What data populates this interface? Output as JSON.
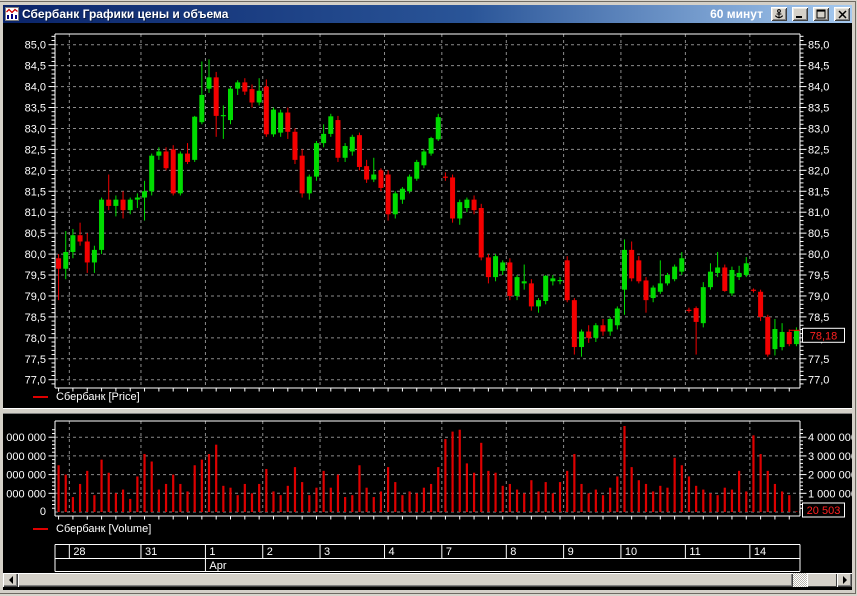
{
  "titlebar": {
    "title": "Сбербанк Графики цены и объема",
    "interval": "60 минут",
    "buttons": {
      "anchor": "anchor",
      "minimize": "minimize",
      "maximize": "maximize",
      "close": "close"
    }
  },
  "price_panel": {
    "legend": "Сбербанк [Price]",
    "y_ticks": [
      "85,0",
      "84,5",
      "84,0",
      "83,5",
      "83,0",
      "82,5",
      "82,0",
      "81,5",
      "81,0",
      "80,5",
      "80,0",
      "79,5",
      "79,0",
      "78,5",
      "78,0",
      "77,5",
      "77,0"
    ],
    "current_price_label": "78,18"
  },
  "volume_panel": {
    "legend": "Сбербанк [Volume]",
    "left_tick_labels": [
      "000 000",
      "000 000",
      "000 000",
      "000 000",
      "0"
    ],
    "right_tick_labels": [
      "4 000 000",
      "3 000 000",
      "2 000 000",
      "1 000 000"
    ],
    "current_volume_label": "20 503"
  },
  "date_axis": {
    "cells": [
      "",
      "28",
      "31",
      "1",
      "2",
      "3",
      "4",
      "7",
      "8",
      "9",
      "10",
      "11",
      "14"
    ],
    "month_label": "Apr",
    "month_start_day_label": "1"
  },
  "colors": {
    "candle_up": "#00DC00",
    "candle_down": "#F40000",
    "volume_bar": "#DE0000",
    "grid": "#8C8C8C",
    "axis_line": "#FFFFFF",
    "axis_text": "#FFFFFF",
    "marker_text": "#FF2020",
    "titlebar_left": "#0A246A",
    "titlebar_right": "#A6CAF0"
  },
  "chart_data": {
    "type": "candlestick+volume",
    "title": "Сбербанк Графики цены и объема",
    "interval": "60 минут",
    "price_ylim": [
      77.0,
      85.0
    ],
    "price_tick_step": 0.5,
    "volume_ylim": [
      0,
      4000000
    ],
    "volume_tick_step": 1000000,
    "grid": true,
    "current": {
      "price": 78.18,
      "volume": 20503
    },
    "days": [
      {
        "label": "",
        "candles": [
          [
            79.9,
            80.0,
            78.9,
            79.65,
            2500000
          ],
          [
            79.65,
            80.55,
            79.4,
            80.05,
            2000000
          ]
        ]
      },
      {
        "label": "28",
        "candles": [
          [
            80.05,
            80.6,
            79.9,
            80.45,
            800000
          ],
          [
            80.45,
            80.75,
            80.2,
            80.3,
            1500000
          ],
          [
            80.3,
            80.5,
            79.55,
            79.8,
            2200000
          ],
          [
            79.8,
            80.2,
            79.55,
            80.1,
            900000
          ],
          [
            80.1,
            81.35,
            80.0,
            81.3,
            2800000
          ],
          [
            81.3,
            81.9,
            81.05,
            81.15,
            2100000
          ],
          [
            81.15,
            81.4,
            80.9,
            81.3,
            1000000
          ],
          [
            81.3,
            81.5,
            80.85,
            81.05,
            1200000
          ],
          [
            81.05,
            81.35,
            80.95,
            81.3,
            700000
          ],
          [
            81.3,
            81.45,
            81.1,
            81.35,
            1900000
          ]
        ]
      },
      {
        "label": "31",
        "candles": [
          [
            81.35,
            81.75,
            80.8,
            81.5,
            3100000
          ],
          [
            81.5,
            82.4,
            81.4,
            82.35,
            2700000
          ],
          [
            82.35,
            82.55,
            82.25,
            82.45,
            1200000
          ],
          [
            82.45,
            82.55,
            82.0,
            82.05,
            1500000
          ],
          [
            82.5,
            82.6,
            81.4,
            81.45,
            2000000
          ],
          [
            81.45,
            82.45,
            81.4,
            82.4,
            1500000
          ],
          [
            82.4,
            82.65,
            82.15,
            82.2,
            1100000
          ],
          [
            82.25,
            83.3,
            82.2,
            83.28,
            2500000
          ],
          [
            83.15,
            84.6,
            83.1,
            83.8,
            2800000
          ]
        ]
      },
      {
        "label": "1",
        "candles": [
          [
            83.95,
            84.65,
            83.85,
            84.22,
            3100000
          ],
          [
            84.22,
            84.35,
            82.8,
            83.3,
            3600000
          ],
          [
            83.3,
            83.55,
            82.75,
            83.32,
            1400000
          ],
          [
            83.2,
            84.0,
            83.1,
            83.95,
            1300000
          ],
          [
            83.95,
            84.15,
            83.8,
            84.1,
            900000
          ],
          [
            84.1,
            84.2,
            83.8,
            83.88,
            1500000
          ],
          [
            83.94,
            84.05,
            83.5,
            83.62,
            1000000
          ],
          [
            83.62,
            84.2,
            83.55,
            83.9,
            1500000
          ]
        ]
      },
      {
        "label": "2",
        "candles": [
          [
            84.0,
            84.17,
            82.8,
            82.86,
            2300000
          ],
          [
            82.86,
            83.5,
            82.8,
            83.45,
            1100000
          ],
          [
            82.9,
            83.45,
            82.8,
            83.38,
            900000
          ],
          [
            83.38,
            83.5,
            82.75,
            82.92,
            1400000
          ],
          [
            82.92,
            83.0,
            82.15,
            82.25,
            2400000
          ],
          [
            82.35,
            82.5,
            81.35,
            81.45,
            1600000
          ],
          [
            81.45,
            81.9,
            81.3,
            81.85,
            900000
          ],
          [
            81.85,
            82.7,
            81.75,
            82.65,
            1300000
          ]
        ]
      },
      {
        "label": "3",
        "candles": [
          [
            82.65,
            83.1,
            82.55,
            82.87,
            2200000
          ],
          [
            82.87,
            83.35,
            82.8,
            83.29,
            1300000
          ],
          [
            83.2,
            83.3,
            82.2,
            82.3,
            2000000
          ],
          [
            82.3,
            82.65,
            82.2,
            82.58,
            800000
          ],
          [
            82.45,
            82.85,
            82.35,
            82.8,
            900000
          ],
          [
            82.84,
            82.9,
            82.0,
            82.08,
            2500000
          ],
          [
            82.1,
            82.25,
            81.7,
            81.78,
            1300000
          ],
          [
            81.78,
            82.3,
            81.72,
            81.9,
            800000
          ],
          [
            82.0,
            82.05,
            81.5,
            81.58,
            1100000
          ]
        ]
      },
      {
        "label": "4",
        "candles": [
          [
            81.9,
            82.0,
            80.8,
            80.95,
            2400000
          ],
          [
            80.95,
            81.5,
            80.85,
            81.45,
            1600000
          ],
          [
            81.3,
            81.6,
            81.2,
            81.56,
            900000
          ],
          [
            81.5,
            81.9,
            81.45,
            81.85,
            1100000
          ],
          [
            81.8,
            82.25,
            81.75,
            82.2,
            1000000
          ],
          [
            82.12,
            82.5,
            82.05,
            82.45,
            1300000
          ],
          [
            82.4,
            82.8,
            82.35,
            82.77,
            1500000
          ],
          [
            82.74,
            83.35,
            82.7,
            83.27,
            2400000
          ]
        ]
      },
      {
        "label": "7",
        "candles": [
          [
            81.85,
            81.95,
            81.75,
            81.83,
            3900000
          ],
          [
            81.83,
            81.9,
            80.75,
            80.85,
            4300000
          ],
          [
            80.85,
            81.3,
            80.7,
            81.24,
            4400000
          ],
          [
            81.1,
            81.35,
            81.0,
            81.3,
            2600000
          ],
          [
            81.3,
            81.4,
            80.95,
            81.05,
            2100000
          ],
          [
            81.1,
            81.2,
            79.85,
            79.92,
            3700000
          ],
          [
            79.92,
            80.0,
            79.3,
            79.45,
            2200000
          ],
          [
            79.45,
            80.0,
            79.35,
            79.95,
            2100000
          ],
          [
            79.6,
            79.85,
            79.5,
            79.8,
            1400000
          ]
        ]
      },
      {
        "label": "8",
        "candles": [
          [
            79.8,
            79.9,
            78.9,
            79.0,
            1500000
          ],
          [
            79.0,
            79.5,
            78.9,
            79.45,
            1200000
          ],
          [
            79.3,
            79.75,
            79.15,
            79.35,
            1000000
          ],
          [
            79.3,
            79.4,
            78.65,
            78.75,
            1700000
          ],
          [
            78.75,
            78.95,
            78.6,
            78.9,
            1100000
          ],
          [
            78.88,
            79.5,
            78.8,
            79.48,
            1600000
          ],
          [
            79.35,
            79.5,
            79.25,
            79.42,
            1000000
          ],
          [
            79.37,
            79.45,
            79.28,
            79.38,
            1600000
          ]
        ]
      },
      {
        "label": "9",
        "candles": [
          [
            79.85,
            79.95,
            78.85,
            78.9,
            2200000
          ],
          [
            78.9,
            78.95,
            77.6,
            77.78,
            3100000
          ],
          [
            77.78,
            78.2,
            77.55,
            78.15,
            1500000
          ],
          [
            78.15,
            78.3,
            77.88,
            78.0,
            1000000
          ],
          [
            78.0,
            78.35,
            77.9,
            78.3,
            1200000
          ],
          [
            78.3,
            78.45,
            78.05,
            78.15,
            900000
          ],
          [
            78.15,
            78.5,
            78.05,
            78.45,
            1300000
          ],
          [
            78.3,
            78.75,
            78.2,
            78.7,
            1900000
          ]
        ]
      },
      {
        "label": "10",
        "candles": [
          [
            79.15,
            80.35,
            78.55,
            80.1,
            4600000
          ],
          [
            80.1,
            80.3,
            79.35,
            79.42,
            2400000
          ],
          [
            79.85,
            79.95,
            79.3,
            79.35,
            1700000
          ],
          [
            79.37,
            79.45,
            78.6,
            78.9,
            1500000
          ],
          [
            78.95,
            79.25,
            78.85,
            79.2,
            1100000
          ],
          [
            79.1,
            79.85,
            79.05,
            79.3,
            1400000
          ],
          [
            79.3,
            79.55,
            79.25,
            79.5,
            1300000
          ],
          [
            79.4,
            79.75,
            79.35,
            79.7,
            2900000
          ],
          [
            79.58,
            80.05,
            79.5,
            79.9,
            2500000
          ]
        ]
      },
      {
        "label": "11",
        "candles": [
          [
            78.67,
            78.72,
            78.6,
            78.65,
            1900000
          ],
          [
            78.71,
            78.75,
            77.6,
            78.38,
            1400000
          ],
          [
            78.35,
            79.33,
            78.25,
            79.21,
            1200000
          ],
          [
            79.21,
            79.78,
            79.15,
            79.58,
            1000000
          ],
          [
            79.55,
            80.05,
            79.45,
            79.68,
            900000
          ],
          [
            79.68,
            79.75,
            79.1,
            79.12,
            1300000
          ],
          [
            79.06,
            79.7,
            79.0,
            79.62,
            1200000
          ],
          [
            79.45,
            79.72,
            79.38,
            79.55,
            2200000
          ],
          [
            79.5,
            79.93,
            79.45,
            79.78,
            1100000
          ]
        ]
      },
      {
        "label": "14",
        "candles": [
          [
            79.15,
            79.18,
            79.08,
            79.13,
            4100000
          ],
          [
            79.1,
            79.15,
            78.4,
            78.5,
            3100000
          ],
          [
            78.5,
            78.55,
            77.55,
            77.6,
            2200000
          ],
          [
            77.73,
            78.45,
            77.58,
            78.21,
            1500000
          ],
          [
            77.78,
            78.35,
            77.7,
            78.14,
            1100000
          ],
          [
            78.14,
            78.2,
            77.8,
            77.85,
            900000
          ],
          [
            77.85,
            78.25,
            77.8,
            78.18,
            20503
          ]
        ]
      }
    ]
  }
}
